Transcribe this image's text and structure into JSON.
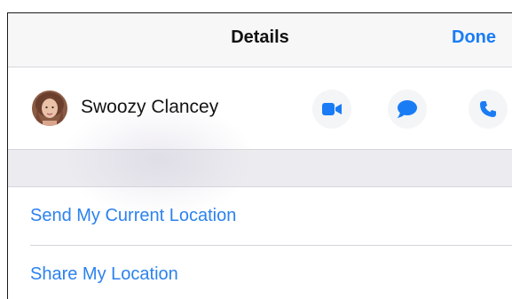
{
  "navbar": {
    "title": "Details",
    "done_label": "Done"
  },
  "contact": {
    "name": "Swoozy Clancey",
    "avatar_icon": "avatar-photo",
    "actions": [
      {
        "icon": "video-camera-icon"
      },
      {
        "icon": "message-bubble-icon"
      },
      {
        "icon": "phone-icon"
      }
    ]
  },
  "location_actions": [
    {
      "label": "Send My Current Location"
    },
    {
      "label": "Share My Location"
    }
  ],
  "colors": {
    "accent": "#1a7cf5",
    "link": "#2b82ee",
    "navbar_bg": "#f7f7f7",
    "grouped_bg": "#ececf0",
    "separator": "#d6d6da"
  }
}
